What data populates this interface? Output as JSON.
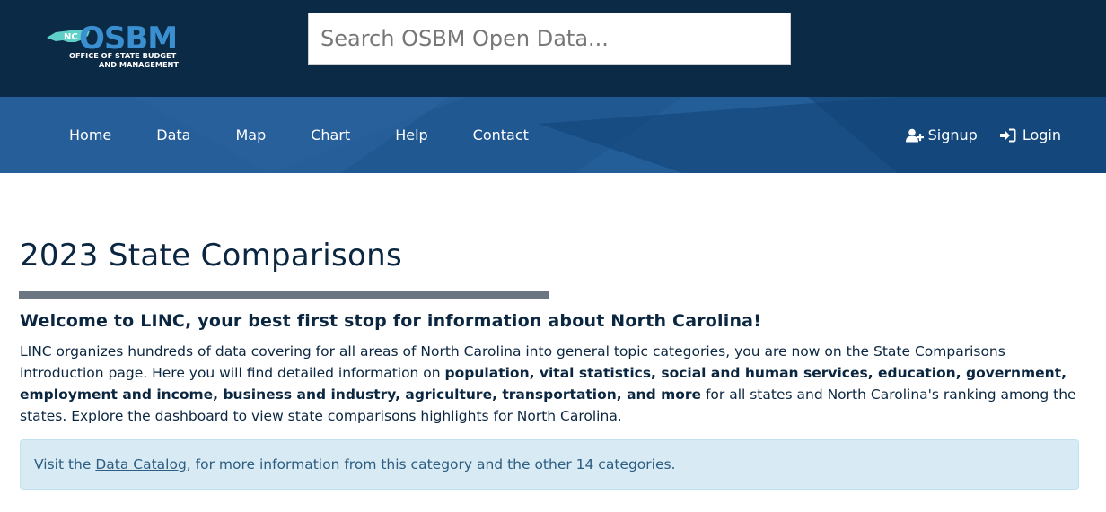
{
  "header": {
    "logo": {
      "badge": "NC",
      "wordmark": "OSBM",
      "line1": "OFFICE OF STATE BUDGET",
      "line2": "AND MANAGEMENT"
    },
    "search": {
      "placeholder": "Search OSBM Open Data...",
      "value": ""
    }
  },
  "nav": {
    "items": [
      {
        "label": "Home"
      },
      {
        "label": "Data"
      },
      {
        "label": "Map"
      },
      {
        "label": "Chart"
      },
      {
        "label": "Help"
      },
      {
        "label": "Contact"
      }
    ],
    "right": [
      {
        "label": "Signup",
        "icon": "user-plus-icon"
      },
      {
        "label": "Login",
        "icon": "sign-in-icon"
      }
    ]
  },
  "main": {
    "title": "2023 State Comparisons",
    "welcome": "Welcome to LINC, your best first stop for information about North Carolina!",
    "intro": {
      "part1": "LINC organizes hundreds of data covering for all areas of North Carolina into general topic categories, you are now on the State Comparisons introduction page. Here you will find detailed information on ",
      "bold": "population, vital statistics, social and human services, education, government, employment and income, business and industry, agriculture, transportation, and more",
      "part2": " for all states and North Carolina's ranking among the states. Explore the dashboard to view state comparisons highlights for North Carolina."
    },
    "alert": {
      "prefix": "Visit the ",
      "link": "Data Catalog",
      "suffix": ", for more information from this category and the other 14 categories."
    }
  },
  "colors": {
    "header_bg": "#0b2a45",
    "nav_bg": "#1d4f86",
    "logo_blue": "#3a8fd0",
    "logo_teal": "#5fd0c8",
    "title_bar": "#6b7682",
    "alert_bg": "#d8ebf5",
    "alert_text": "#2d5d80"
  }
}
